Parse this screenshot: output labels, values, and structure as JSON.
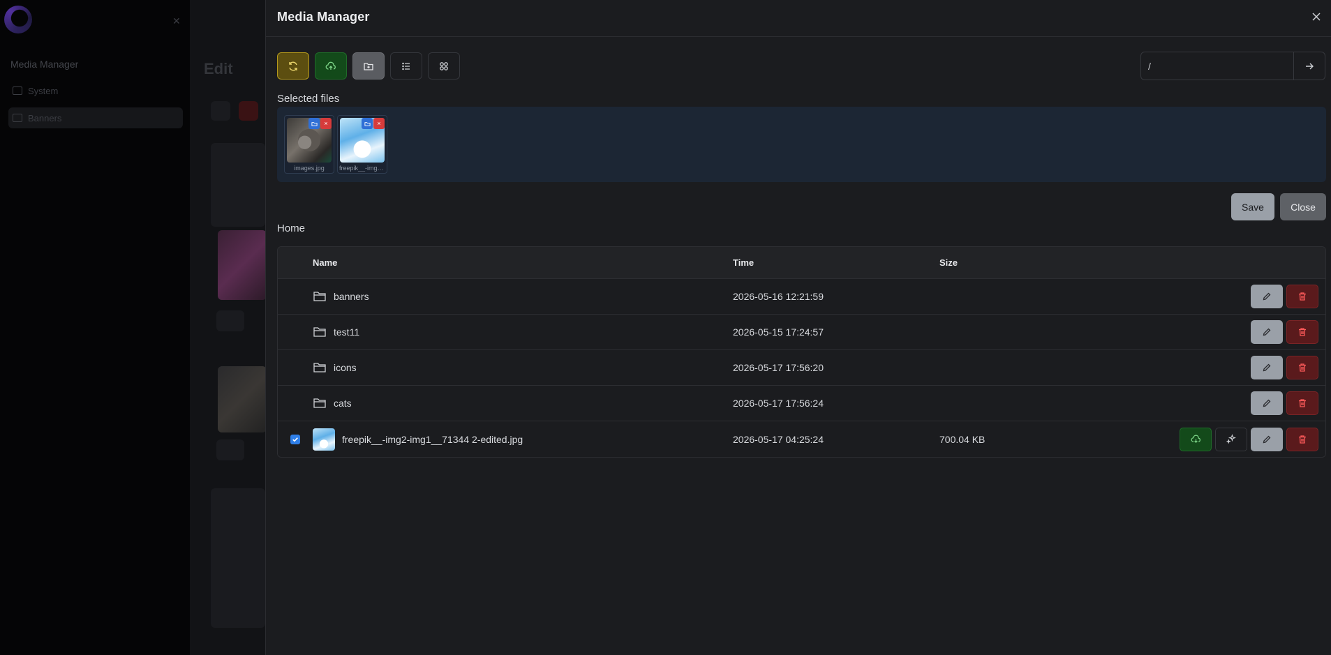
{
  "background": {
    "sidebar_section": "Media Manager",
    "sidebar_items": [
      {
        "label": "System"
      },
      {
        "label": "Banners"
      }
    ],
    "page_title": "Edit"
  },
  "modal": {
    "title": "Media Manager",
    "toolbar": {
      "icons": [
        "refresh-icon",
        "upload-cloud-icon",
        "new-folder-icon",
        "list-view-icon",
        "grid-view-icon"
      ]
    },
    "path": {
      "value": "/"
    },
    "selected_label": "Selected files",
    "selected_files": [
      {
        "caption": "images.jpg"
      },
      {
        "caption": "freepik__-img2-img1__71344 2-edited.jpg"
      }
    ],
    "save_label": "Save",
    "close_label": "Close",
    "breadcrumb": "Home",
    "table": {
      "headers": {
        "name": "Name",
        "time": "Time",
        "size": "Size"
      },
      "rows": [
        {
          "name": "banners",
          "time": "2026-05-16 12:21:59",
          "size": ""
        },
        {
          "name": "test11",
          "time": "2026-05-15 17:24:57",
          "size": ""
        },
        {
          "name": "icons",
          "time": "2026-05-17 17:56:20",
          "size": ""
        },
        {
          "name": "cats",
          "time": "2026-05-17 17:56:24",
          "size": ""
        },
        {
          "name": "freepik__-img2-img1__71344 2-edited.jpg",
          "time": "2026-05-17 04:25:24",
          "size": "700.04 KB"
        }
      ]
    }
  },
  "colors": {
    "accent_yellow": "#b59a1c",
    "accent_green": "#1f6b29",
    "danger": "#d63b3b",
    "primary_blue": "#2f7fe8"
  }
}
